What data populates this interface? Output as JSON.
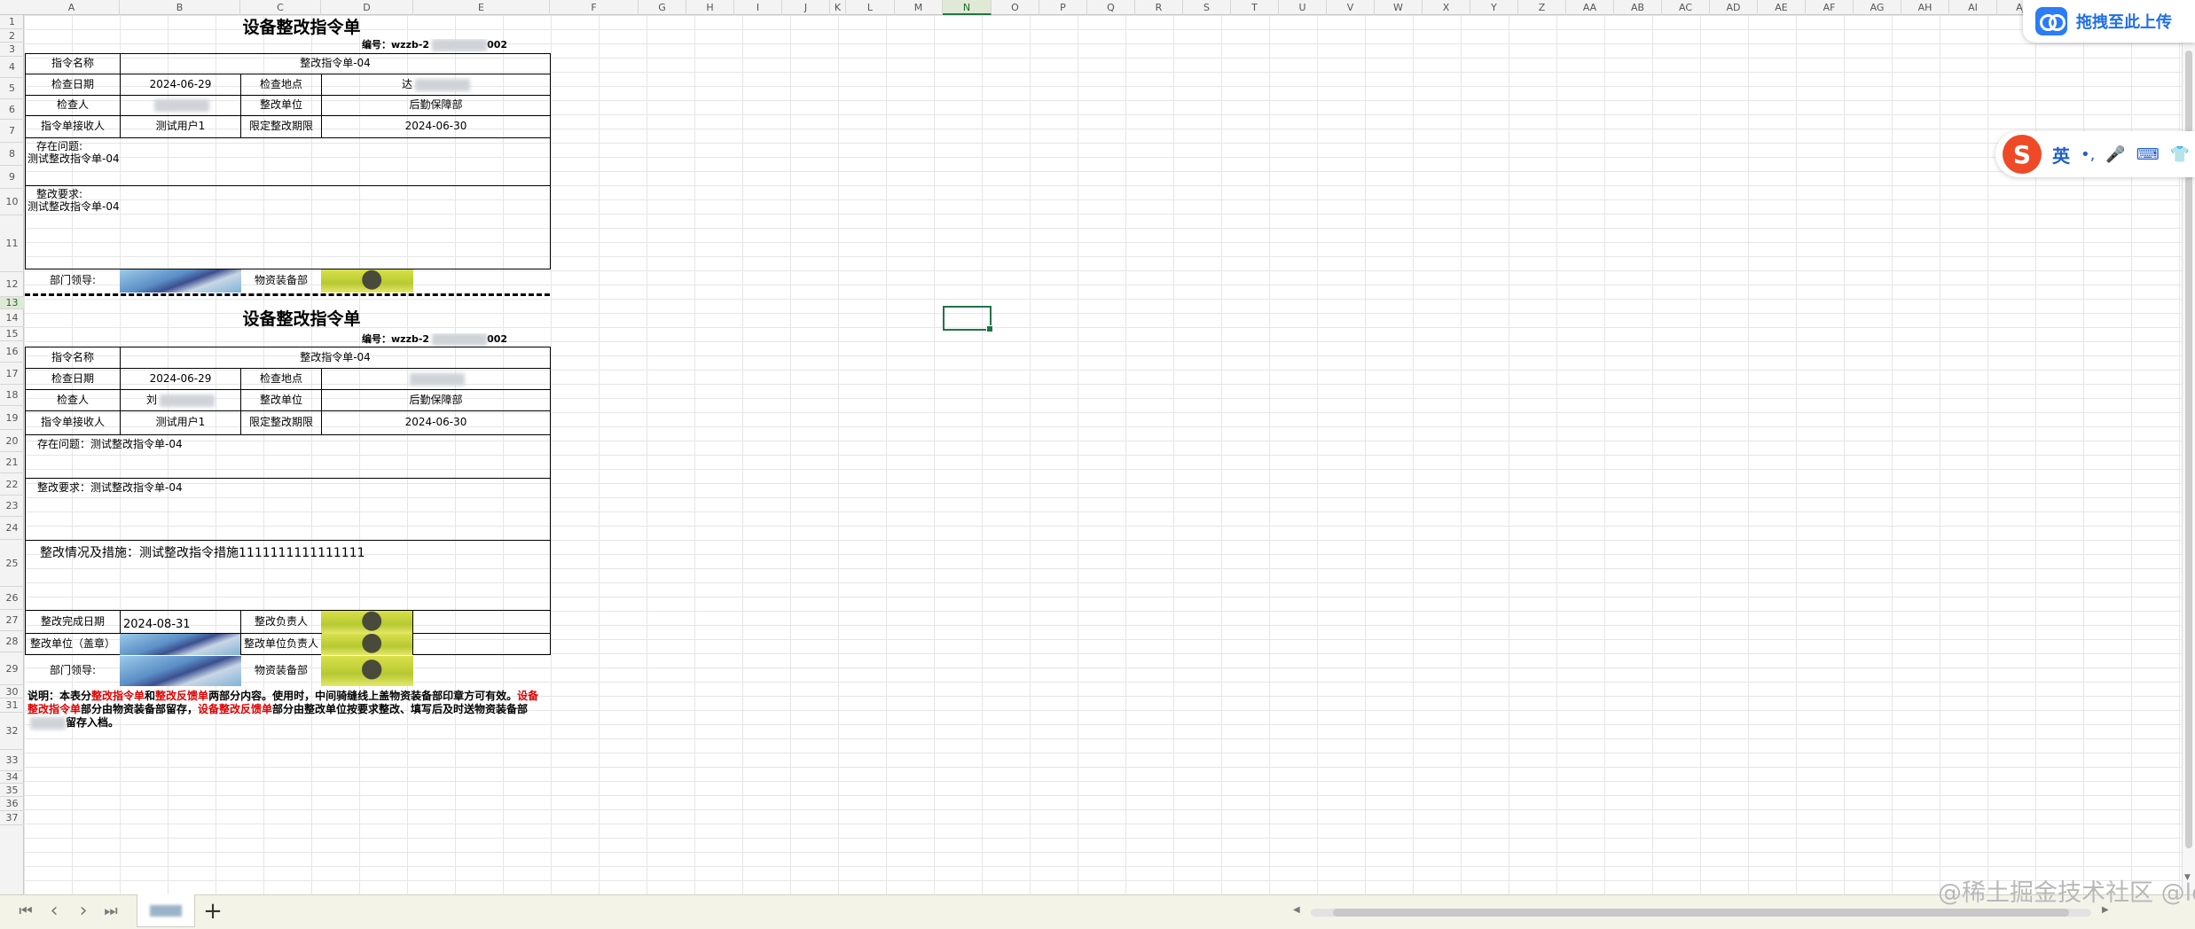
{
  "columns": [
    "A",
    "B",
    "C",
    "D",
    "E",
    "F",
    "G",
    "H",
    "I",
    "J",
    "K",
    "L",
    "M",
    "N",
    "O",
    "P",
    "Q",
    "R",
    "S",
    "T",
    "U",
    "V",
    "W",
    "X",
    "Y",
    "Z",
    "AA",
    "AB",
    "AC",
    "AD",
    "AE",
    "AF",
    "AG",
    "AH",
    "AI",
    "AJ"
  ],
  "selected_column": "N",
  "selected_row": "13",
  "form1": {
    "title": "设备整改指令单",
    "code_prefix": "编号：wzzb-2",
    "code_suffix": "002",
    "lbl_name": "指令名称",
    "val_name": "整改指令单-04",
    "lbl_date": "检查日期",
    "val_date": "2024-06-29",
    "lbl_place": "检查地点",
    "val_place": "达",
    "lbl_inspector": "检查人",
    "lbl_unit": "整改单位",
    "val_unit": "后勤保障部",
    "lbl_receiver": "指令单接收人",
    "val_receiver": "测试用户1",
    "lbl_deadline": "限定整改期限",
    "val_deadline": "2024-06-30",
    "problem_label": "存在问题:",
    "problem_value": "测试整改指令单-04",
    "req_label": "整改要求:",
    "req_value": "测试整改指令单-04",
    "lbl_leader": "部门领导:",
    "lbl_dept": "物资装备部"
  },
  "form2": {
    "title": "设备整改指令单",
    "code_prefix": "编号：wzzb-2",
    "code_suffix": "002",
    "lbl_name": "指令名称",
    "val_name": "整改指令单-04",
    "lbl_date": "检查日期",
    "val_date": "2024-06-29",
    "lbl_place": "检查地点",
    "lbl_inspector": "检查人",
    "val_inspector": "刘",
    "lbl_unit": "整改单位",
    "val_unit": "后勤保障部",
    "lbl_receiver": "指令单接收人",
    "val_receiver": "测试用户1",
    "lbl_deadline": "限定整改期限",
    "val_deadline": "2024-06-30",
    "problem": "存在问题：测试整改指令单-04",
    "requirement": "整改要求：测试整改指令单-04",
    "measures": "整改情况及措施：测试整改指令措施1111111111111111",
    "lbl_done_date": "整改完成日期",
    "val_done_date": "2024-08-31",
    "lbl_owner": "整改负责人",
    "lbl_seal": "整改单位（盖章）",
    "lbl_unit_owner": "整改单位负责人",
    "lbl_leader": "部门领导:",
    "lbl_dept": "物资装备部"
  },
  "note": {
    "p1": "说明：本表分",
    "r1": "整改指令单",
    "p2": "和",
    "r2": "整改反馈单",
    "p3": "两部分内容。使用时，中间骑缝线上盖物资装备部印章方可有效。",
    "r3": "设备整改指令单",
    "p4": "部分由物资装备部留存，",
    "r4": "设备整改反馈单",
    "p5": "部分由整改单位按要求整改、填写后及时送物资装备部",
    "p6": "留存入档。"
  },
  "upload": {
    "label": "拖拽至此上传"
  },
  "ime": {
    "logo": "S",
    "lang": "英",
    "punct": "•,",
    "mic": "🎤",
    "kbd": "⌨",
    "shirt": "👕"
  },
  "tabs": {
    "first": "⏮",
    "prev": "‹",
    "next": "›",
    "last": "⏭",
    "add": "+"
  },
  "watermark": "@稀土掘金技术社区 @lotoze"
}
